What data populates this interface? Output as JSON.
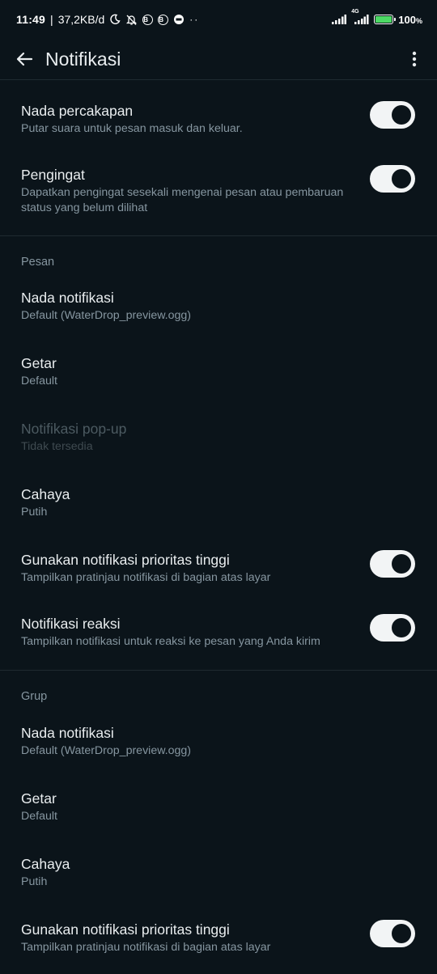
{
  "status_bar": {
    "time": "11:49",
    "net_speed": "37,2KB/d",
    "network_label": "4G",
    "battery": "100",
    "battery_unit": "%",
    "battery_level": 1.0,
    "battery_color": "#4cd964"
  },
  "header": {
    "title": "Notifikasi"
  },
  "top": {
    "items": [
      {
        "title": "Nada percakapan",
        "subtitle": "Putar suara untuk pesan masuk dan keluar.",
        "toggle": true
      },
      {
        "title": "Pengingat",
        "subtitle": "Dapatkan pengingat sesekali mengenai pesan atau pembaruan status yang belum dilihat",
        "toggle": true
      }
    ]
  },
  "pesan": {
    "header": "Pesan",
    "items": [
      {
        "title": "Nada notifikasi",
        "subtitle": "Default (WaterDrop_preview.ogg)"
      },
      {
        "title": "Getar",
        "subtitle": "Default"
      },
      {
        "title": "Notifikasi pop-up",
        "subtitle": "Tidak tersedia",
        "disabled": true
      },
      {
        "title": "Cahaya",
        "subtitle": "Putih"
      },
      {
        "title": "Gunakan notifikasi prioritas tinggi",
        "subtitle": "Tampilkan pratinjau notifikasi di bagian atas layar",
        "toggle": true
      },
      {
        "title": "Notifikasi reaksi",
        "subtitle": "Tampilkan notifikasi untuk reaksi ke pesan yang Anda kirim",
        "toggle": true
      }
    ]
  },
  "grup": {
    "header": "Grup",
    "items": [
      {
        "title": "Nada notifikasi",
        "subtitle": "Default (WaterDrop_preview.ogg)"
      },
      {
        "title": "Getar",
        "subtitle": "Default"
      },
      {
        "title": "Cahaya",
        "subtitle": "Putih"
      },
      {
        "title": "Gunakan notifikasi prioritas tinggi",
        "subtitle": "Tampilkan pratinjau notifikasi di bagian atas layar",
        "toggle": true
      }
    ]
  },
  "colors": {
    "background": "#0b141a",
    "primary_text": "#e9edef",
    "secondary_text": "#8696a0",
    "toggle_track": "#f2f4f5"
  },
  "icons": {
    "back": "arrow-left-icon",
    "menu": "more-vert-icon"
  }
}
